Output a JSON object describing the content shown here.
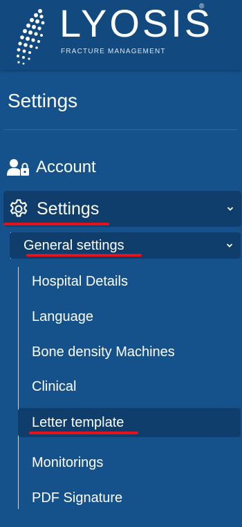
{
  "brand": {
    "name": "LYOSIS",
    "registered": "®",
    "tagline": "FRACTURE MANAGEMENT"
  },
  "page": {
    "title": "Settings"
  },
  "menu": {
    "account": {
      "label": "Account",
      "icon": "user-lock-icon"
    },
    "settings": {
      "label": "Settings",
      "icon": "gear-icon",
      "expanded": true
    },
    "general_settings": {
      "label": "General settings",
      "expanded": true
    },
    "items": [
      {
        "label": "Hospital Details"
      },
      {
        "label": "Language"
      },
      {
        "label": "Bone density Machines"
      },
      {
        "label": "Clinical"
      },
      {
        "label": "Letter template",
        "active": true
      },
      {
        "label": "Monitorings"
      },
      {
        "label": "PDF Signature"
      }
    ]
  },
  "colors": {
    "background": "#15528c",
    "header": "#124a7f",
    "selected": "#0f3e6c",
    "annotation": "#e4121a"
  }
}
